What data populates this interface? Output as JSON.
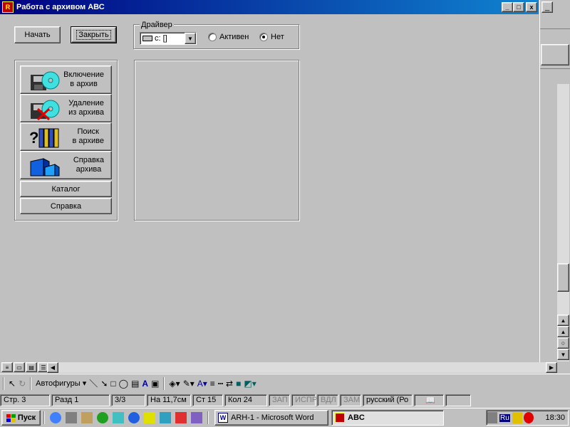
{
  "window": {
    "title": "Работа с архивом АВС",
    "icon": "abc-app-icon",
    "min": "_",
    "max": "□",
    "close": "x"
  },
  "toolbar": {
    "start_label": "Начать",
    "close_label": "Закрыть"
  },
  "driver": {
    "group_label": "Драйвер",
    "selected": "c: []",
    "radio_active_label": "Активен",
    "radio_none_label": "Нет",
    "selected_radio": "Нет"
  },
  "menu": {
    "items": [
      {
        "line1": "Включение",
        "line2": "в архив",
        "icon": "floppy-cd-icon"
      },
      {
        "line1": "Удаление",
        "line2": "из архива",
        "icon": "floppy-cd-delete-icon"
      },
      {
        "line1": "Поиск",
        "line2": "в архиве",
        "icon": "books-search-icon"
      },
      {
        "line1": "Справка",
        "line2": "архива",
        "icon": "blue-cubes-icon"
      }
    ],
    "catalog_label": "Каталог",
    "help_label": "Справка"
  },
  "drawing_toolbar": {
    "autoshapes_label": "Автофигуры"
  },
  "status": {
    "page": "Стр. 3",
    "section": "Разд 1",
    "pages": "3/3",
    "at": "На 11,7см",
    "line": "Ст 15",
    "col": "Кол 24",
    "rec": "ЗАП",
    "trk": "ИСПР",
    "ext": "ВДЛ",
    "ovr": "ЗАМ",
    "lang": "русский (Ро"
  },
  "taskbar": {
    "start_label": "Пуск",
    "tasks": [
      {
        "label": "ARH-1 - Microsoft Word",
        "icon": "word-icon"
      },
      {
        "label": "ABC",
        "icon": "abc-app-icon"
      }
    ],
    "tray_lang": "Ru",
    "clock": "18:30"
  },
  "colors": {
    "title_active": "#000080",
    "face": "#c0c0c0"
  }
}
